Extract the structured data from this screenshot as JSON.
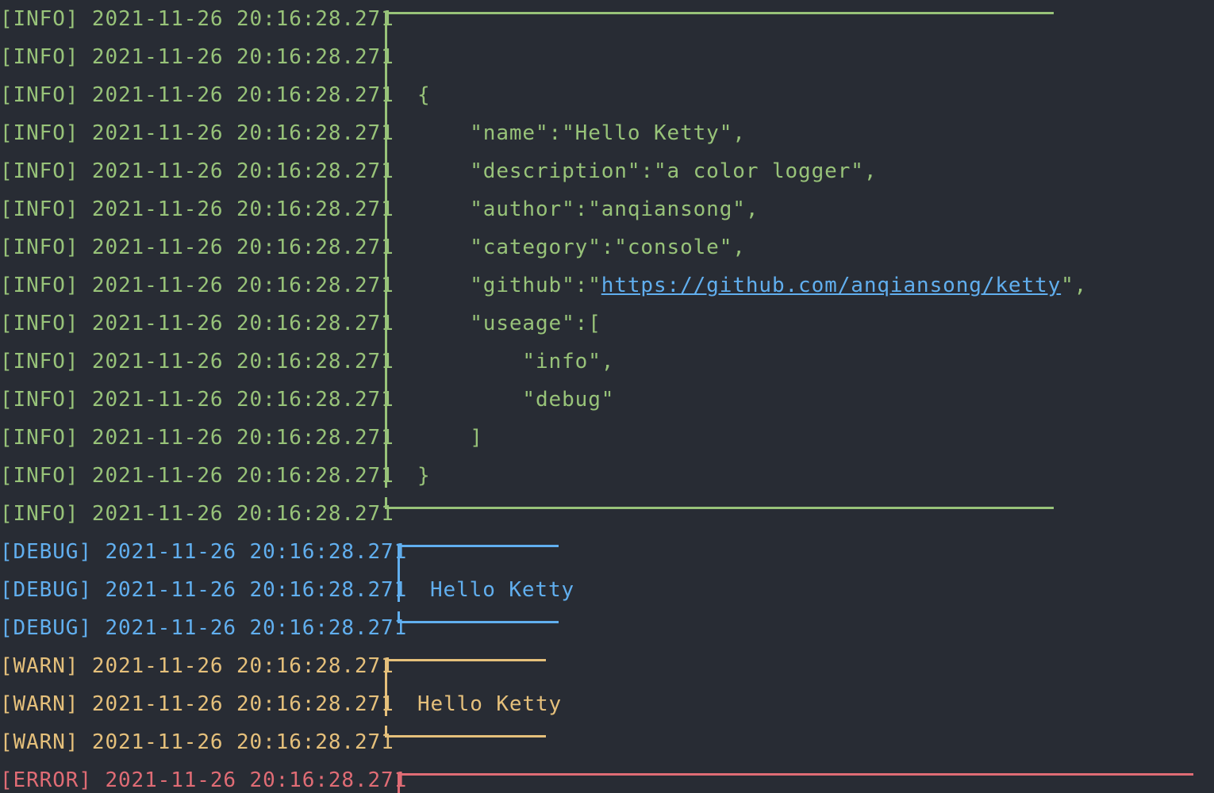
{
  "colors": {
    "background": "#282c34",
    "info": "#98c379",
    "debug": "#61afef",
    "warn": "#e5c07b",
    "error": "#e06c75",
    "json_text": "#98c379",
    "link": "#61afef"
  },
  "log": {
    "timestamp": "2021-11-26 20:16:28.271",
    "info": {
      "tag": "[INFO]",
      "content_lines": [
        "",
        "",
        "{",
        "    \"name\":\"Hello Ketty\",",
        "    \"description\":\"a color logger\",",
        "    \"author\":\"anqiansong\",",
        "    \"category\":\"console\",",
        "    \"github\":\"",
        "    \"useage\":[",
        "        \"info\",",
        "        \"debug\"",
        "    ]",
        "}",
        ""
      ],
      "github_link": "https://github.com/anqiansong/ketty",
      "github_suffix": "\","
    },
    "debug": {
      "tag": "[DEBUG]",
      "message": "Hello Ketty"
    },
    "warn": {
      "tag": "[WARN]",
      "message": "Hello Ketty"
    },
    "error": {
      "tag": "[ERROR]"
    }
  }
}
